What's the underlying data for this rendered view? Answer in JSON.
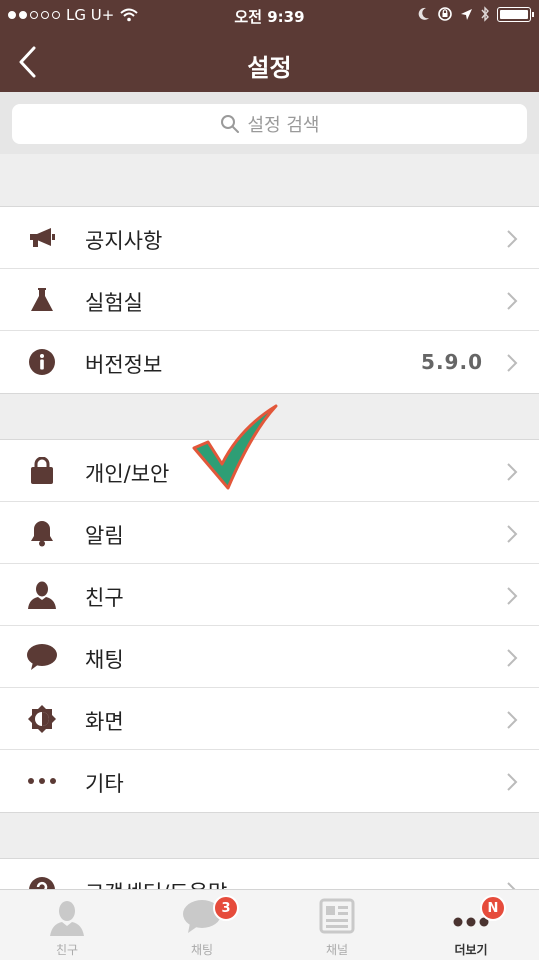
{
  "status_bar": {
    "carrier": "LG U+",
    "time": "오전 9:39"
  },
  "nav": {
    "title": "설정"
  },
  "search": {
    "placeholder": "설정 검색"
  },
  "section1": [
    {
      "label": "공지사항",
      "icon": "megaphone-icon"
    },
    {
      "label": "실험실",
      "icon": "flask-icon"
    },
    {
      "label": "버전정보",
      "icon": "info-icon",
      "value": "5.9.0"
    }
  ],
  "section2": [
    {
      "label": "개인/보안",
      "icon": "lock-icon"
    },
    {
      "label": "알림",
      "icon": "bell-icon"
    },
    {
      "label": "친구",
      "icon": "person-icon"
    },
    {
      "label": "채팅",
      "icon": "speech-bubble-icon"
    },
    {
      "label": "화면",
      "icon": "brightness-icon"
    },
    {
      "label": "기타",
      "icon": "more-dots-icon"
    }
  ],
  "section3": [
    {
      "label": "고객센터/도움말",
      "icon": "help-icon"
    }
  ],
  "tabs": [
    {
      "label": "친구",
      "icon": "friends-tab-icon"
    },
    {
      "label": "채팅",
      "icon": "chat-tab-icon",
      "badge": "3"
    },
    {
      "label": "채널",
      "icon": "channel-tab-icon"
    },
    {
      "label": "더보기",
      "icon": "more-tab-icon",
      "badge": "N",
      "active": true
    }
  ],
  "colors": {
    "header": "#5b3a35",
    "icon": "#5b3a35",
    "badge": "#e64c3c",
    "checkmark": "#2e9e75",
    "checkmark_outline": "#e2573a"
  }
}
